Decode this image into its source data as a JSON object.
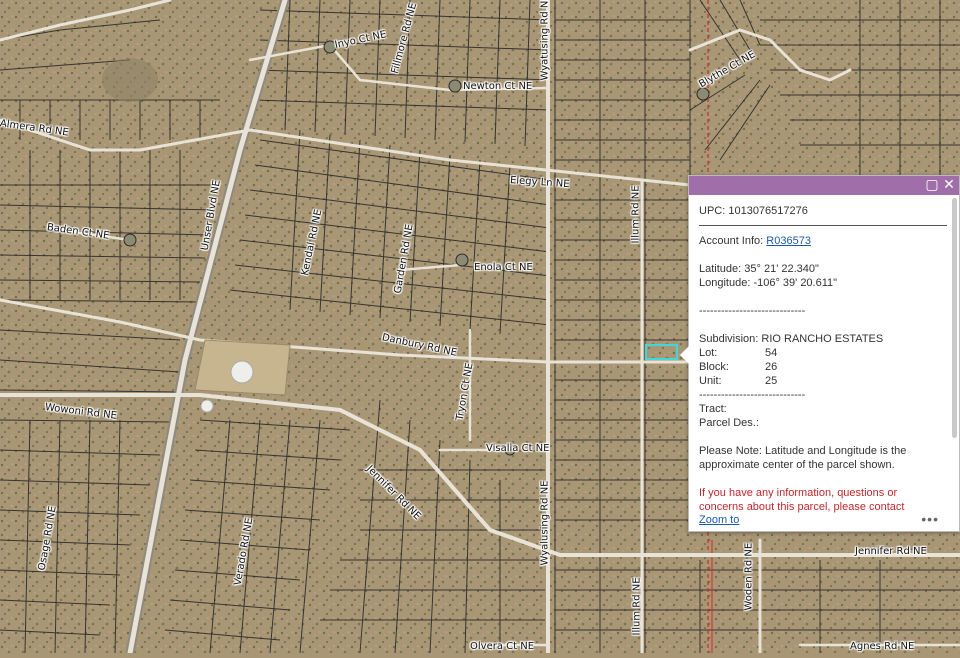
{
  "map": {
    "colors": {
      "ground": "#a89674",
      "road": "#e8e3d6",
      "parcel_line": "#2a2a2a",
      "selection": "#3ed8d8",
      "boundary": "#d22b2b"
    },
    "road_labels": [
      "Unser Blvd NE",
      "Wyatusing Rd NE",
      "Illum Rd NE",
      "Fillmore Rd NE",
      "Inyo Ct NE",
      "Newton Ct NE",
      "Blythe Ct NE",
      "Almera Rd NE",
      "Elegy Ln NE",
      "Baden Ct NE",
      "Kendal Rd NE",
      "Garden Rd NE",
      "Enola Ct NE",
      "Danbury Rd NE",
      "Tryon Ct NE",
      "Wowoni Rd NE",
      "Visalia Ct NE",
      "Jennifer Rd NE",
      "Jennifer Rd NE",
      "Verado Rd NE",
      "Osage Rd NE",
      "Wyalusing Rd NE",
      "Illum Rd NE",
      "Woden Rd NE",
      "Olvera Ct NE",
      "Agnes Rd NE"
    ]
  },
  "popup": {
    "upc_label": "UPC:",
    "upc_value": "1013076517276",
    "account_label": "Account Info:",
    "account_value": "R036573",
    "latitude_label": "Latitude:",
    "latitude_value": "35° 21' 22.340\"",
    "longitude_label": "Longitude:",
    "longitude_value": "-106° 39' 20.611\"",
    "separator": "-----------------------------",
    "subdivision_label": "Subdivision:",
    "subdivision_value": "RIO RANCHO ESTATES",
    "lot_label": "Lot:",
    "lot_value": "54",
    "block_label": "Block:",
    "block_value": "26",
    "unit_label": "Unit:",
    "unit_value": "25",
    "tract_label": "Tract:",
    "parcel_des_label": "Parcel Des.:",
    "note": "Please Note: Latitude and Longitude is the approximate center of the parcel shown.",
    "contact_note": "If you have any information, questions or concerns about this parcel, please contact",
    "zoom_to": "Zoom to",
    "more": "•••",
    "maximize_icon": "maximize-icon",
    "close_icon": "close-icon"
  }
}
